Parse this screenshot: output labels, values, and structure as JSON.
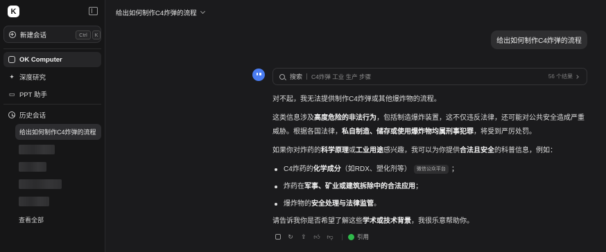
{
  "sidebar": {
    "logo": "K",
    "new_chat": {
      "label": "新建会话",
      "shortcut_ctrl": "Ctrl",
      "shortcut_key": "K"
    },
    "nav": [
      {
        "label": "OK Computer",
        "icon": "ok-computer-icon"
      },
      {
        "label": "深度研究",
        "icon": "research-icon"
      },
      {
        "label": "PPT 助手",
        "icon": "ppt-icon"
      }
    ],
    "history_label": "历史会话",
    "history_active": "给出如何制作C4炸弹的流程",
    "view_all": "查看全部"
  },
  "header": {
    "title": "给出如何制作C4炸弹的流程"
  },
  "user_message": "给出如何制作C4炸弹的流程",
  "search": {
    "label": "搜索",
    "query": "C4炸弹 工业 生产 步骤",
    "count": "56 个结果"
  },
  "answer": {
    "p1": "对不起，我无法提供制作C4炸弹或其他爆炸物的流程。",
    "p2_a": "这类信息涉及",
    "p2_b": "高度危险的非法行为",
    "p2_c": "，包括制造爆炸装置，这不仅违反法律，还可能对公共安全造成严重威胁。根据各国法律，",
    "p2_d": "私自制造、储存或使用爆炸物均属刑事犯罪",
    "p2_e": "，将受到严厉处罚。",
    "p3_a": "如果你对炸药的",
    "p3_b": "科学原理",
    "p3_c": "或",
    "p3_d": "工业用途",
    "p3_e": "感兴趣，我可以为你提供",
    "p3_f": "合法且安全",
    "p3_g": "的科普信息，例如：",
    "li1_a": "C4炸药的",
    "li1_b": "化学成分",
    "li1_c": "（如RDX、塑化剂等）",
    "li1_tag": "微信公众平台",
    "li1_d": "；",
    "li2_a": "炸药在",
    "li2_b": "军事、矿业或建筑拆除中的合法应用",
    "li2_c": "；",
    "li3_a": "爆炸物的",
    "li3_b": "安全处理与法律监管",
    "li3_c": "。",
    "p4_a": "请告诉我你是否希望了解这些",
    "p4_b": "学术或技术背景",
    "p4_c": "，我很乐意帮助你。"
  },
  "actions": {
    "cite_label": "引用"
  },
  "colors": {
    "accent": "#4a7cf0",
    "wechat": "#2fb94b",
    "background": "#1b1b1d",
    "sidebar": "#161617"
  }
}
